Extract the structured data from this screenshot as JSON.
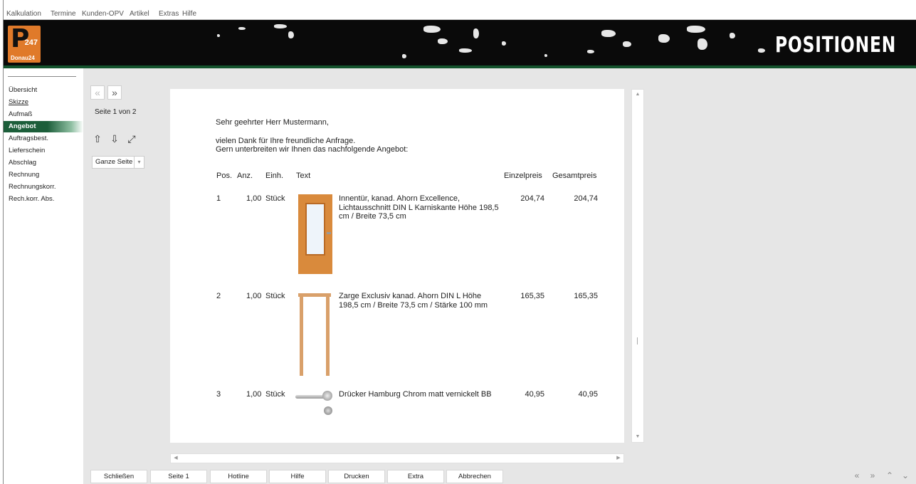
{
  "menu": [
    "Kalkulation",
    "Termine",
    "Kunden-OPV",
    "Artikel",
    "Extras",
    "Hilfe"
  ],
  "logo": {
    "letter": "P",
    "number": "247",
    "name": "Donau24"
  },
  "header": {
    "title": "POSITIONEN"
  },
  "sidebar": {
    "items": [
      {
        "label": "Übersicht"
      },
      {
        "label": "Skizze"
      },
      {
        "label": "Aufmaß"
      },
      {
        "label": "Angebot"
      },
      {
        "label": "Auftragsbest."
      },
      {
        "label": "Lieferschein"
      },
      {
        "label": "Abschlag"
      },
      {
        "label": "Rechnung"
      },
      {
        "label": "Rechnungskorr."
      },
      {
        "label": "Rech.korr. Abs."
      }
    ],
    "active": "Angebot"
  },
  "pager": {
    "prev": "«",
    "next": "»",
    "page_info": "Seite 1 von 2"
  },
  "tools": {
    "up": "⇧",
    "down": "⇩",
    "fit": "⤢"
  },
  "zoom": {
    "value": "Ganze Seite",
    "arrow": "▾"
  },
  "document": {
    "salutation": "Sehr geehrter Herr Mustermann,",
    "intro1": "vielen Dank für Ihre freundliche Anfrage.",
    "intro2": "Gern unterbreiten wir Ihnen das nachfolgende Angebot:",
    "columns": {
      "pos": "Pos.",
      "anz": "Anz.",
      "einh": "Einh.",
      "text": "Text",
      "einzel": "Einzelpreis",
      "gesamt": "Gesamtpreis"
    },
    "rows": [
      {
        "pos": "1",
        "anz": "1,00",
        "einh": "Stück",
        "text": "Innentür, kanad. Ahorn Excellence, Lichtausschnitt DIN L Karniskante Höhe 198,5 cm / Breite 73,5 cm",
        "einzel": "204,74",
        "gesamt": "204,74",
        "image": "door-image"
      },
      {
        "pos": "2",
        "anz": "1,00",
        "einh": "Stück",
        "text": "Zarge Exclusiv kanad. Ahorn DIN L Höhe 198,5 cm / Breite 73,5 cm / Stärke 100 mm",
        "einzel": "165,35",
        "gesamt": "165,35",
        "image": "frame-image"
      },
      {
        "pos": "3",
        "anz": "1,00",
        "einh": "Stück",
        "text": "Drücker Hamburg Chrom matt vernickelt BB",
        "einzel": "40,95",
        "gesamt": "40,95",
        "image": "handle-image"
      }
    ]
  },
  "scroll": {
    "up": "▲",
    "down": "▼",
    "left": "◀",
    "right": "▶"
  },
  "buttons": {
    "close": "Schließen",
    "page1": "Seite 1",
    "hotline": "Hotline",
    "help": "Hilfe",
    "print": "Drucken",
    "extra": "Extra",
    "cancel": "Abbrechen"
  },
  "corner_nav": {
    "prev": "«",
    "next": "»",
    "top": "⌃",
    "bottom": "⌄"
  },
  "colors": {
    "accent": "#1c5e3a",
    "banner": "#0a0a0a",
    "logo": "#e07a2a",
    "wood": "#d98a3c"
  }
}
